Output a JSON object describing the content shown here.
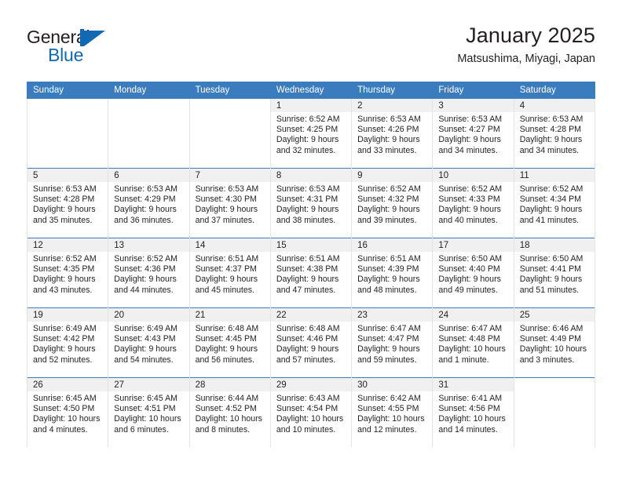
{
  "brand": {
    "name_part1": "General",
    "name_part2": "Blue",
    "logo_icon": "sail-triangle-icon",
    "accent_color": "#1268b3"
  },
  "header": {
    "title": "January 2025",
    "subtitle": "Matsushima, Miyagi, Japan",
    "header_bg_color": "#3a7cbe",
    "daynum_bg_color": "#f0f0f0"
  },
  "calendar": {
    "columns": [
      "Sunday",
      "Monday",
      "Tuesday",
      "Wednesday",
      "Thursday",
      "Friday",
      "Saturday"
    ],
    "weeks": [
      [
        {
          "day": "",
          "lines": []
        },
        {
          "day": "",
          "lines": []
        },
        {
          "day": "",
          "lines": []
        },
        {
          "day": "1",
          "lines": [
            "Sunrise: 6:52 AM",
            "Sunset: 4:25 PM",
            "Daylight: 9 hours",
            "and 32 minutes."
          ]
        },
        {
          "day": "2",
          "lines": [
            "Sunrise: 6:53 AM",
            "Sunset: 4:26 PM",
            "Daylight: 9 hours",
            "and 33 minutes."
          ]
        },
        {
          "day": "3",
          "lines": [
            "Sunrise: 6:53 AM",
            "Sunset: 4:27 PM",
            "Daylight: 9 hours",
            "and 34 minutes."
          ]
        },
        {
          "day": "4",
          "lines": [
            "Sunrise: 6:53 AM",
            "Sunset: 4:28 PM",
            "Daylight: 9 hours",
            "and 34 minutes."
          ]
        }
      ],
      [
        {
          "day": "5",
          "lines": [
            "Sunrise: 6:53 AM",
            "Sunset: 4:28 PM",
            "Daylight: 9 hours",
            "and 35 minutes."
          ]
        },
        {
          "day": "6",
          "lines": [
            "Sunrise: 6:53 AM",
            "Sunset: 4:29 PM",
            "Daylight: 9 hours",
            "and 36 minutes."
          ]
        },
        {
          "day": "7",
          "lines": [
            "Sunrise: 6:53 AM",
            "Sunset: 4:30 PM",
            "Daylight: 9 hours",
            "and 37 minutes."
          ]
        },
        {
          "day": "8",
          "lines": [
            "Sunrise: 6:53 AM",
            "Sunset: 4:31 PM",
            "Daylight: 9 hours",
            "and 38 minutes."
          ]
        },
        {
          "day": "9",
          "lines": [
            "Sunrise: 6:52 AM",
            "Sunset: 4:32 PM",
            "Daylight: 9 hours",
            "and 39 minutes."
          ]
        },
        {
          "day": "10",
          "lines": [
            "Sunrise: 6:52 AM",
            "Sunset: 4:33 PM",
            "Daylight: 9 hours",
            "and 40 minutes."
          ]
        },
        {
          "day": "11",
          "lines": [
            "Sunrise: 6:52 AM",
            "Sunset: 4:34 PM",
            "Daylight: 9 hours",
            "and 41 minutes."
          ]
        }
      ],
      [
        {
          "day": "12",
          "lines": [
            "Sunrise: 6:52 AM",
            "Sunset: 4:35 PM",
            "Daylight: 9 hours",
            "and 43 minutes."
          ]
        },
        {
          "day": "13",
          "lines": [
            "Sunrise: 6:52 AM",
            "Sunset: 4:36 PM",
            "Daylight: 9 hours",
            "and 44 minutes."
          ]
        },
        {
          "day": "14",
          "lines": [
            "Sunrise: 6:51 AM",
            "Sunset: 4:37 PM",
            "Daylight: 9 hours",
            "and 45 minutes."
          ]
        },
        {
          "day": "15",
          "lines": [
            "Sunrise: 6:51 AM",
            "Sunset: 4:38 PM",
            "Daylight: 9 hours",
            "and 47 minutes."
          ]
        },
        {
          "day": "16",
          "lines": [
            "Sunrise: 6:51 AM",
            "Sunset: 4:39 PM",
            "Daylight: 9 hours",
            "and 48 minutes."
          ]
        },
        {
          "day": "17",
          "lines": [
            "Sunrise: 6:50 AM",
            "Sunset: 4:40 PM",
            "Daylight: 9 hours",
            "and 49 minutes."
          ]
        },
        {
          "day": "18",
          "lines": [
            "Sunrise: 6:50 AM",
            "Sunset: 4:41 PM",
            "Daylight: 9 hours",
            "and 51 minutes."
          ]
        }
      ],
      [
        {
          "day": "19",
          "lines": [
            "Sunrise: 6:49 AM",
            "Sunset: 4:42 PM",
            "Daylight: 9 hours",
            "and 52 minutes."
          ]
        },
        {
          "day": "20",
          "lines": [
            "Sunrise: 6:49 AM",
            "Sunset: 4:43 PM",
            "Daylight: 9 hours",
            "and 54 minutes."
          ]
        },
        {
          "day": "21",
          "lines": [
            "Sunrise: 6:48 AM",
            "Sunset: 4:45 PM",
            "Daylight: 9 hours",
            "and 56 minutes."
          ]
        },
        {
          "day": "22",
          "lines": [
            "Sunrise: 6:48 AM",
            "Sunset: 4:46 PM",
            "Daylight: 9 hours",
            "and 57 minutes."
          ]
        },
        {
          "day": "23",
          "lines": [
            "Sunrise: 6:47 AM",
            "Sunset: 4:47 PM",
            "Daylight: 9 hours",
            "and 59 minutes."
          ]
        },
        {
          "day": "24",
          "lines": [
            "Sunrise: 6:47 AM",
            "Sunset: 4:48 PM",
            "Daylight: 10 hours",
            "and 1 minute."
          ]
        },
        {
          "day": "25",
          "lines": [
            "Sunrise: 6:46 AM",
            "Sunset: 4:49 PM",
            "Daylight: 10 hours",
            "and 3 minutes."
          ]
        }
      ],
      [
        {
          "day": "26",
          "lines": [
            "Sunrise: 6:45 AM",
            "Sunset: 4:50 PM",
            "Daylight: 10 hours",
            "and 4 minutes."
          ]
        },
        {
          "day": "27",
          "lines": [
            "Sunrise: 6:45 AM",
            "Sunset: 4:51 PM",
            "Daylight: 10 hours",
            "and 6 minutes."
          ]
        },
        {
          "day": "28",
          "lines": [
            "Sunrise: 6:44 AM",
            "Sunset: 4:52 PM",
            "Daylight: 10 hours",
            "and 8 minutes."
          ]
        },
        {
          "day": "29",
          "lines": [
            "Sunrise: 6:43 AM",
            "Sunset: 4:54 PM",
            "Daylight: 10 hours",
            "and 10 minutes."
          ]
        },
        {
          "day": "30",
          "lines": [
            "Sunrise: 6:42 AM",
            "Sunset: 4:55 PM",
            "Daylight: 10 hours",
            "and 12 minutes."
          ]
        },
        {
          "day": "31",
          "lines": [
            "Sunrise: 6:41 AM",
            "Sunset: 4:56 PM",
            "Daylight: 10 hours",
            "and 14 minutes."
          ]
        },
        {
          "day": "",
          "lines": []
        }
      ]
    ]
  }
}
